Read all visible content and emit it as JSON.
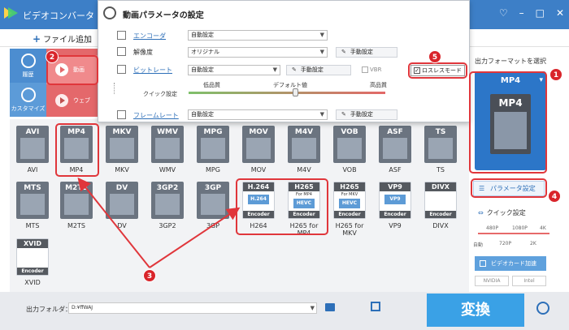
{
  "window": {
    "title": "ビデオコンバータ",
    "controls": [
      "♡",
      "–",
      "□",
      "✕"
    ]
  },
  "toolbar": {
    "add_file_label": "ファイル追加"
  },
  "nav": {
    "history_label": "履歴",
    "customize_label": "カスタマイズ"
  },
  "categories": [
    {
      "label": "動画"
    },
    {
      "label": "ウェブ"
    }
  ],
  "formats_row1": [
    "AVI",
    "MP4",
    "MKV",
    "WMV",
    "MPG",
    "MOV",
    "M4V",
    "VOB",
    "ASF",
    "TS"
  ],
  "formats_row2": [
    {
      "label": "MTS",
      "code": "MTS"
    },
    {
      "label": "M2TS",
      "code": "M2TS"
    },
    {
      "label": "DV",
      "code": "DV"
    },
    {
      "label": "3GP2",
      "code": "3GP2"
    },
    {
      "label": "3GP",
      "code": "3GP"
    },
    {
      "label": "H264",
      "code": "H.264",
      "sub": "H.264",
      "foot": "Encoder"
    },
    {
      "label": "H265 for MP4",
      "code": "H265",
      "sub": "HEVC",
      "for": "For MP4",
      "foot": "Encoder"
    },
    {
      "label": "H265 for MKV",
      "code": "H265",
      "sub": "HEVC",
      "for": "For MKV",
      "foot": "Encoder"
    },
    {
      "label": "VP9",
      "code": "VP9",
      "sub": "VP9",
      "foot": "Encoder"
    },
    {
      "label": "DIVX",
      "code": "DIVX",
      "foot": "Encoder"
    }
  ],
  "formats_row3": [
    {
      "label": "XVID",
      "code": "XVID",
      "foot": "Encoder"
    }
  ],
  "right_panel": {
    "output_format_label": "出力フォーマットを選択",
    "selected_format": "MP4",
    "param_button": "パラメータ設定",
    "quick_setting_label": "クイック設定",
    "quick_ticks_top": [
      "480P",
      "1080P",
      "4K"
    ],
    "quick_ticks_bottom": [
      "自動",
      "720P",
      "2K"
    ],
    "hw_accel_label": "ビデオカード加速",
    "badges": [
      "NVIDIA",
      "Intel"
    ]
  },
  "bottom": {
    "output_folder_label": "出力フォルダ：",
    "output_folder_value": "D:¥ffWAJ",
    "convert_label": "変換"
  },
  "dialog": {
    "title": "動画パラメータの設定",
    "rows": {
      "encoder": {
        "label": "エンコーダ",
        "value": "自動設定"
      },
      "resolution": {
        "label": "解像度",
        "value": "オリジナル",
        "manual": "手動設定"
      },
      "bitrate": {
        "label": "ビットレート",
        "value": "自動設定",
        "manual": "手動設定",
        "vbr": "VBR"
      },
      "quick": {
        "label": "クイック設定",
        "low": "低品質",
        "default": "デフォルト値",
        "high": "高品質"
      },
      "framerate": {
        "label": "フレームレート",
        "value": "自動設定",
        "manual": "手動設定"
      }
    },
    "lossless_label": "ロスレスモード"
  },
  "annotations": [
    "1",
    "2",
    "3",
    "4",
    "5"
  ]
}
